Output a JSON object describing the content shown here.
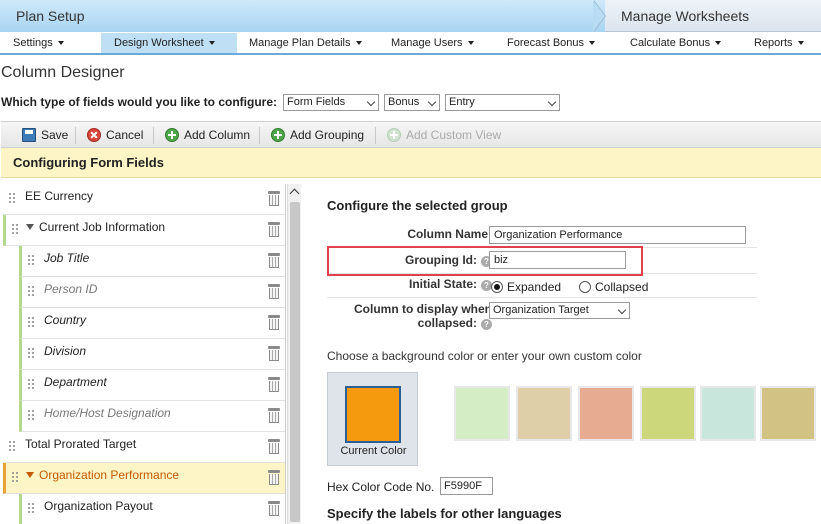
{
  "breadcrumb": {
    "step1": "Plan Setup",
    "step2": "Manage Worksheets"
  },
  "nav": [
    "Settings",
    "Design Worksheet",
    "Manage Plan Details",
    "Manage Users",
    "Forecast Bonus",
    "Calculate Bonus",
    "Reports"
  ],
  "nav_active": "Design Worksheet",
  "page_title": "Column Designer",
  "field_type": {
    "question": "Which type of fields would you like to configure:",
    "select1": "Form Fields",
    "select2": "Bonus",
    "select3": "Entry"
  },
  "toolbar": {
    "save": "Save",
    "cancel": "Cancel",
    "add_column": "Add Column",
    "add_grouping": "Add Grouping",
    "add_custom_view": "Add Custom View"
  },
  "config_header": "Configuring Form Fields",
  "left_items": [
    {
      "label": "EE Currency"
    },
    {
      "label": "Current Job Information"
    },
    {
      "label": "Job Title"
    },
    {
      "label": "Person ID"
    },
    {
      "label": "Country"
    },
    {
      "label": "Division"
    },
    {
      "label": "Department"
    },
    {
      "label": "Home/Host Designation"
    },
    {
      "label": "Total Prorated Target"
    },
    {
      "label": "Organization Performance"
    },
    {
      "label": "Organization Payout"
    }
  ],
  "right": {
    "title": "Configure the selected group",
    "column_name_label": "Column Name:",
    "column_name_value": "Organization Performance",
    "grouping_id_label": "Grouping Id:",
    "grouping_id_value": "biz",
    "initial_state_label": "Initial State:",
    "expanded": "Expanded",
    "collapsed": "Collapsed",
    "collapsed_col_label_1": "Column to display when",
    "collapsed_col_label_2": "collapsed:",
    "collapsed_col_value": "Organization Target",
    "help_glyph": "?",
    "bg_prompt": "Choose a background color or enter your own custom color",
    "current_color_label": "Current Color",
    "hex_label": "Hex Color Code No.",
    "hex_value": "F5990F",
    "languages_heading": "Specify the labels for other languages"
  },
  "colors": {
    "current": "#F5990F",
    "swatches": [
      "#d4edc4",
      "#dfcfa9",
      "#e6ab90",
      "#ccd67a",
      "#c8e6dc",
      "#d2c283"
    ]
  }
}
